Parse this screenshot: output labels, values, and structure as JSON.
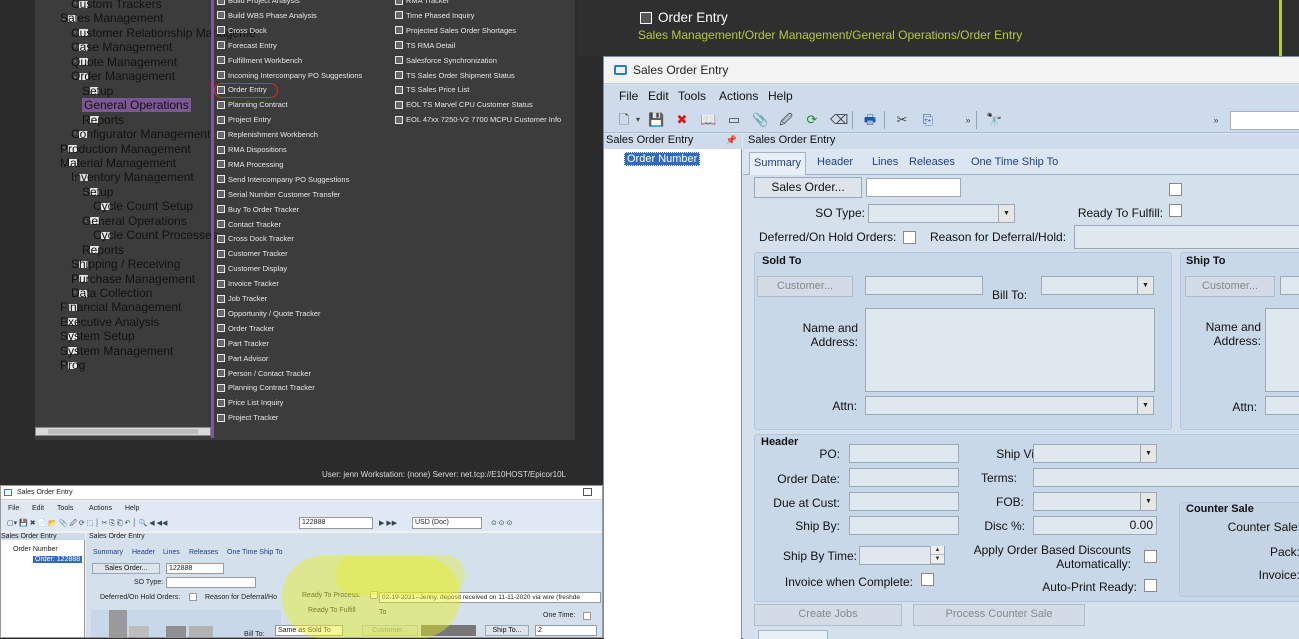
{
  "background_menu": {
    "tree": [
      {
        "label": "Custom Trackers",
        "indent": 2,
        "arrow": "›"
      },
      {
        "label": "Sales Management",
        "indent": 1,
        "arrow": "⌄"
      },
      {
        "label": "Customer Relationship Manageme",
        "indent": 2,
        "arrow": "›"
      },
      {
        "label": "Case Management",
        "indent": 2,
        "arrow": "›"
      },
      {
        "label": "Quote Management",
        "indent": 2,
        "arrow": "›"
      },
      {
        "label": "Order Management",
        "indent": 2,
        "arrow": "⌄"
      },
      {
        "label": "Setup",
        "indent": 3,
        "arrow": ""
      },
      {
        "label": "General Operations",
        "indent": 3,
        "arrow": "",
        "selected": true
      },
      {
        "label": "Reports",
        "indent": 3,
        "arrow": ""
      },
      {
        "label": "Configurator Management",
        "indent": 2,
        "arrow": "›"
      },
      {
        "label": "Production Management",
        "indent": 1,
        "arrow": "›"
      },
      {
        "label": "Material Management",
        "indent": 1,
        "arrow": "⌄"
      },
      {
        "label": "Inventory Management",
        "indent": 2,
        "arrow": "⌄"
      },
      {
        "label": "Setup",
        "indent": 3,
        "arrow": "⌄"
      },
      {
        "label": "Cycle Count Setup",
        "indent": 4,
        "arrow": ""
      },
      {
        "label": "General Operations",
        "indent": 3,
        "arrow": "⌄"
      },
      {
        "label": "Cycle Count Processes",
        "indent": 4,
        "arrow": ""
      },
      {
        "label": "Reports",
        "indent": 3,
        "arrow": ""
      },
      {
        "label": "Shipping / Receiving",
        "indent": 2,
        "arrow": "›"
      },
      {
        "label": "Purchase Management",
        "indent": 2,
        "arrow": "›"
      },
      {
        "label": "Data Collection",
        "indent": 2,
        "arrow": "›"
      },
      {
        "label": "Financial Management",
        "indent": 1,
        "arrow": "›"
      },
      {
        "label": "Executive Analysis",
        "indent": 1,
        "arrow": "›"
      },
      {
        "label": "System Setup",
        "indent": 1,
        "arrow": "›"
      },
      {
        "label": "System Management",
        "indent": 1,
        "arrow": "›"
      },
      {
        "label": "Prog",
        "indent": 1,
        "arrow": "›"
      }
    ],
    "programs_col1": [
      "Build Project Analysis",
      "Build WBS Phase Analysis",
      "Cross Dock",
      "Forecast Entry",
      "Fulfillment Workbench",
      "Incoming Intercompany PO Suggestions",
      "Order Entry",
      "Planning Contract",
      "Project Entry",
      "Replenishment Workbench",
      "RMA Dispositions",
      "RMA Processing",
      "Send Intercompany PO Suggestions",
      "Serial Number Customer Transfer",
      "Buy To Order Tracker",
      "Contact Tracker",
      "Cross Dock Tracker",
      "Customer Tracker",
      "Customer Display",
      "Invoice Tracker",
      "Job Tracker",
      "Opportunity / Quote Tracker",
      "Order Tracker",
      "Part Tracker",
      "Part Advisor",
      "Person / Contact Tracker",
      "Planning Contract Tracker",
      "Price List Inquiry",
      "Project Tracker"
    ],
    "programs_col2": [
      "RMA Tracker",
      "Time Phased Inquiry",
      "Projected Sales Order Shortages",
      "TS RMA Detail",
      "Salesforce Synchronization",
      "TS Sales Order Shipment Status",
      "TS Sales Price List",
      "EOL TS Marvel CPU Customer Status",
      "EOL 47xx 7250-V2 7700 MCPU Customer Info"
    ],
    "status_line": "User:  jenn     Workstation:  (none)     Server:  net.tcp://E10HOST/Epicor10L"
  },
  "page_header": {
    "title": "Order Entry",
    "breadcrumb": "Sales Management/Order Management/General Operations/Order Entry"
  },
  "small_window": {
    "title": "Sales Order Entry",
    "menus": [
      "File",
      "Edit",
      "Tools",
      "Actions",
      "Help"
    ],
    "order_value": "122888",
    "currency": "USD (Doc)",
    "tree_header": "Sales Order Entry",
    "content_header": "Sales Order Entry",
    "tree_root": "Order Number",
    "tree_child": "Order: 122888",
    "tabs": [
      "Summary",
      "Header",
      "Lines",
      "Releases",
      "One Time Ship To"
    ],
    "sales_order_btn": "Sales Order...",
    "sales_order_value": "122888",
    "so_type": "SO Type:",
    "deferred": "Deferred/On Hold Orders:",
    "reason": "Reason for Deferral/Ho",
    "ready_to_process": "Ready To Process:",
    "ready_to_fulfill": "Ready To Fulfill",
    "comment": "02-19-2021--Jenny. deposit received on 11-11-2020 via wire (freshde",
    "one_time": "One Time:",
    "bill_to": "Bill To:",
    "bill_to_value": "Same as Sold To",
    "customer_btn": "Customer...",
    "ship_to_btn": "Ship To...",
    "ship_to_value": "2",
    "to_label": "To"
  },
  "main_window": {
    "title": "Sales Order Entry",
    "menus": [
      "File",
      "Edit",
      "Tools",
      "Actions",
      "Help"
    ],
    "tree_header": "Sales Order Entry",
    "tree_node": "Order Number",
    "content_header": "Sales Order Entry",
    "tabs": [
      "Summary",
      "Header",
      "Lines",
      "Releases",
      "One Time Ship To"
    ],
    "summary": {
      "sales_order_btn": "Sales Order...",
      "so_type_label": "SO Type:",
      "ready_to_fulfill_label": "Ready To Fulfill:",
      "deferred_label": "Deferred/On Hold Orders:",
      "reason_label": "Reason for Deferral/Hold:",
      "sold_to": {
        "title": "Sold To",
        "customer_btn": "Customer...",
        "bill_to_label": "Bill To:",
        "name_address_label": "Name and\nAddress:",
        "attn_label": "Attn:"
      },
      "ship_to": {
        "title": "Ship To",
        "customer_btn": "Customer...",
        "name_address_label": "Name and\nAddress:",
        "attn_label": "Attn:"
      },
      "header": {
        "title": "Header",
        "po_label": "PO:",
        "order_date_label": "Order Date:",
        "due_at_cust_label": "Due at Cust:",
        "ship_by_label": "Ship By:",
        "ship_by_time_label": "Ship By Time:",
        "invoice_when_complete_label": "Invoice when Complete:",
        "ship_via_label": "Ship Via:",
        "terms_label": "Terms:",
        "fob_label": "FOB:",
        "disc_label": "Disc %:",
        "disc_value": "0.00",
        "apply_discounts_label": "Apply Order Based Discounts\nAutomatically:",
        "auto_print_label": "Auto-Print Ready:"
      },
      "counter_sale": {
        "title": "Counter Sale",
        "counter_sale_label": "Counter Sale:",
        "pack_label": "Pack:",
        "invoice_label": "Invoice:"
      },
      "create_jobs_btn": "Create Jobs",
      "process_counter_sale_btn": "Process Counter Sale"
    }
  },
  "colors": {
    "menu_purple": "#7e5796",
    "breadcrumb_green": "#b7c93c",
    "tree_select_blue": "#316ac5",
    "window_blue": "#cddbeb",
    "highlight_yellow": "#e8f01e"
  }
}
